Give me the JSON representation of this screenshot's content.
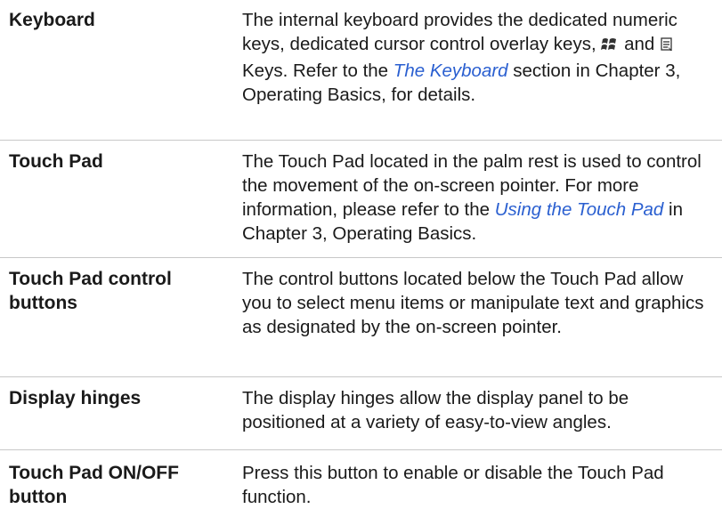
{
  "rows": [
    {
      "term": "Keyboard",
      "desc": {
        "p1": "The internal keyboard provides the dedicated numeric keys, dedicated cursor control overlay keys,",
        "p2": "and",
        "p3": "Keys. Refer to the",
        "link": "The Keyboard",
        "p4": "section in Chapter 3, Operating Basics, for details."
      },
      "icons": [
        "windows-logo-icon",
        "application-menu-icon"
      ]
    },
    {
      "term": "Touch Pad",
      "desc": {
        "p1": "The Touch Pad located in the palm rest is used to control the movement of the on-screen pointer. For more information, please refer to the",
        "link": "Using the Touch Pad",
        "p2": "in Chapter 3, Operating Basics."
      }
    },
    {
      "term": "Touch Pad control buttons",
      "desc": "The control buttons located below the Touch Pad allow you to select menu items or manipulate text and graphics as designated by the on-screen pointer."
    },
    {
      "term": "Display hinges",
      "desc": "The display hinges allow the display panel to be positioned at a variety of easy-to-view angles."
    },
    {
      "term": "Touch Pad ON/OFF button",
      "desc": "Press this button to enable or disable the Touch Pad function."
    }
  ]
}
